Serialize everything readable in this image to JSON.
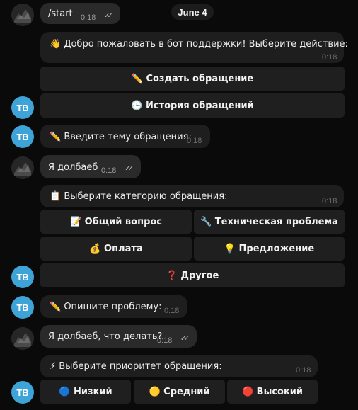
{
  "date_label": "June 4",
  "bot_avatar_initials": "TB",
  "messages": [
    {
      "text": "/start",
      "time": "0:18"
    },
    {
      "text": "👋 Добро пожаловать в бот поддержки! Выберите действие:",
      "time": "0:18"
    },
    {
      "text": "✏️ Введите тему обращения:",
      "time": "0:18"
    },
    {
      "text": "Я долбаеб",
      "time": "0:18"
    },
    {
      "text": "📋 Выберите категорию обращения:",
      "time": "0:18"
    },
    {
      "text": "✏️ Опишите проблему:",
      "time": "0:18"
    },
    {
      "text": "Я долбаеб, что делать?",
      "time": "0:18"
    },
    {
      "text": "⚡ Выберите приоритет обращения:",
      "time": "0:18"
    }
  ],
  "main_menu_buttons": [
    "✏️ Создать обращение",
    "🕒 История обращений"
  ],
  "category_buttons": [
    "📝 Общий вопрос",
    "🔧 Техническая проблема",
    "💰 Оплата",
    "💡 Предложение",
    "❓ Другое"
  ],
  "priority_buttons": [
    "🔵 Низкий",
    "🟡 Средний",
    "🔴 Высокий"
  ],
  "colors": {
    "background": "#0a0a0a",
    "bubble": "#1e1e1e",
    "bot_avatar": "#3ea3d7"
  }
}
